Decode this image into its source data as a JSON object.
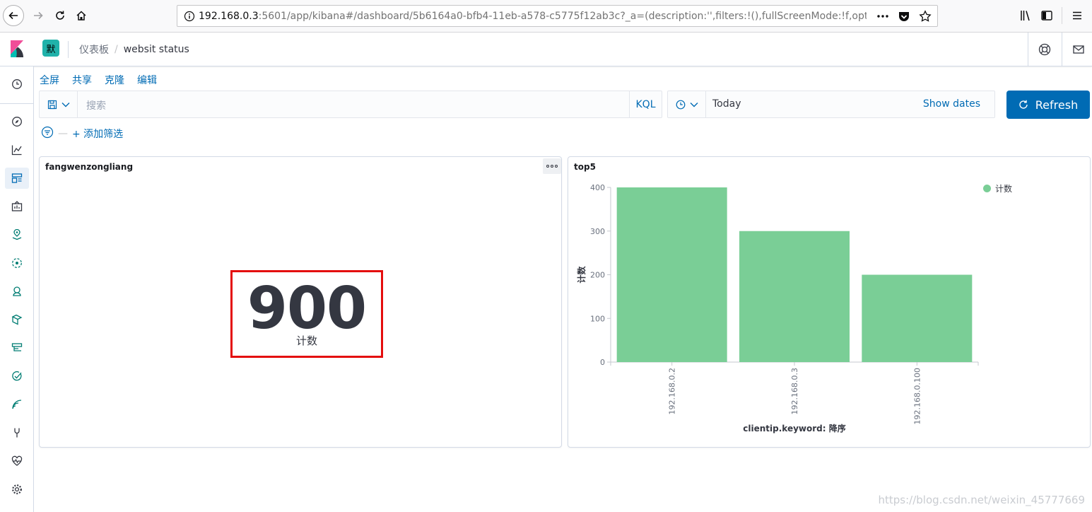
{
  "browser": {
    "url_host": "192.168.0.3",
    "url_rest": ":5601/app/kibana#/dashboard/5b6164a0-bfb4-11eb-a578-c5775f12ab3c?_a=(description:'',filters:!(),fullScreenMode:!f,options:(hideP"
  },
  "header": {
    "space_initial": "默",
    "breadcrumb_parent": "仪表板",
    "breadcrumb_sep": "/",
    "breadcrumb_current": "websit status"
  },
  "top_menu": {
    "fullscreen": "全屏",
    "share": "共享",
    "clone": "克隆",
    "edit": "编辑"
  },
  "query": {
    "placeholder": "搜索",
    "language": "KQL"
  },
  "date": {
    "value": "Today",
    "show_dates": "Show dates"
  },
  "refresh_label": "Refresh",
  "filters": {
    "dash": "—",
    "add_label": "+ 添加筛选"
  },
  "panels": {
    "metric": {
      "title": "fangwenzongliang",
      "value": "900",
      "label": "计数"
    },
    "bar": {
      "title": "top5"
    }
  },
  "chart_data": {
    "type": "bar",
    "title": "top5",
    "categories": [
      "192.168.0.2",
      "192.168.0.3",
      "192.168.0.100"
    ],
    "series": [
      {
        "name": "计数",
        "values": [
          400,
          300,
          200
        ],
        "color": "#7ace96"
      }
    ],
    "xlabel": "clientip.keyword: 降序",
    "ylabel": "计数",
    "ylim": [
      0,
      400
    ],
    "yticks": [
      0,
      100,
      200,
      300,
      400
    ],
    "grid": false,
    "legend_position": "top-right"
  },
  "colors": {
    "accent": "#006bb4",
    "bar": "#7ace96",
    "highlight_box": "#e40d0d"
  },
  "watermark": "https://blog.csdn.net/weixin_45777669"
}
